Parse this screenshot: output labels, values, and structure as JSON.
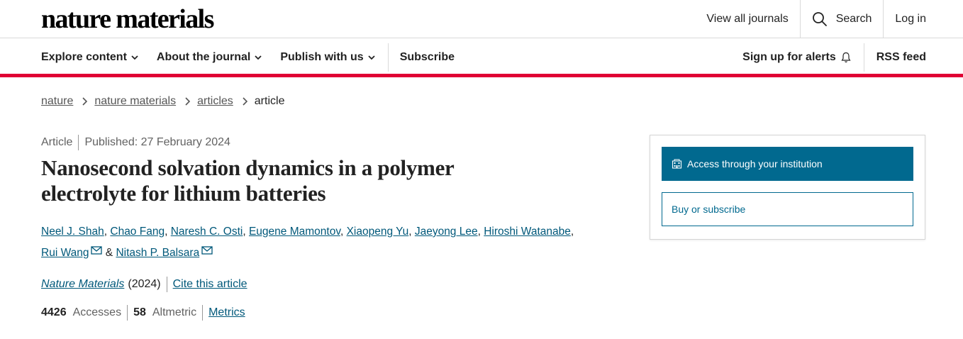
{
  "header": {
    "logo": "nature materials",
    "view_all_journals": "View all journals",
    "search_label": "Search",
    "login_label": "Log in"
  },
  "nav": {
    "explore": "Explore content",
    "about": "About the journal",
    "publish": "Publish with us",
    "subscribe": "Subscribe",
    "alerts": "Sign up for alerts",
    "rss": "RSS feed"
  },
  "breadcrumb": {
    "items": [
      "nature",
      "nature materials",
      "articles"
    ],
    "current": "article"
  },
  "article": {
    "type": "Article",
    "published": "Published: 27 February 2024",
    "title": "Nanosecond solvation dynamics in a polymer electrolyte for lithium batteries",
    "authors": [
      "Neel J. Shah",
      "Chao Fang",
      "Naresh C. Osti",
      "Eugene Mamontov",
      "Xiaopeng Yu",
      "Jaeyong Lee",
      "Hiroshi Watanabe",
      "Rui Wang",
      "Nitash P. Balsara"
    ],
    "journal": "Nature Materials",
    "year": "(2024)",
    "cite_label": "Cite this article",
    "accesses_count": "4426",
    "accesses_label": "Accesses",
    "altmetric_count": "58",
    "altmetric_label": "Altmetric",
    "metrics_label": "Metrics"
  },
  "access": {
    "institution_label": "Access through your institution",
    "buy_label": "Buy or subscribe"
  },
  "colors": {
    "accent_red": "#e00034",
    "link_blue": "#00587a",
    "button_blue": "#01698f"
  },
  "icons": [
    "search-icon",
    "chevron-down-icon",
    "bell-icon",
    "chevron-right-icon",
    "mail-icon",
    "institution-icon"
  ]
}
